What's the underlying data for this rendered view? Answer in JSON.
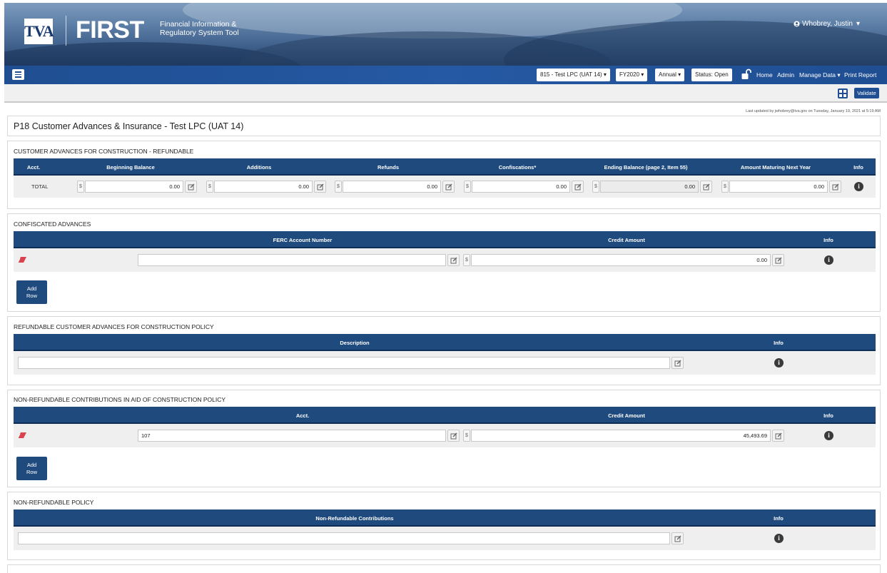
{
  "header": {
    "logo_tva": "TVA",
    "logo_first": "FIRST",
    "logo_subtitle_line1": "Financial Information &",
    "logo_subtitle_line2": "Regulatory System Tool",
    "user_name": "Whobrey, Justin",
    "user_caret": "▾"
  },
  "navbar": {
    "entity_select": "815 - Test LPC (UAT 14) ▾",
    "year_select": "FY2020 ▾",
    "period_select": "Annual ▾",
    "status": "Status: Open",
    "links": {
      "home": "Home",
      "admin": "Admin",
      "manage_data": "Manage Data ▾",
      "print_report": "Print Report"
    }
  },
  "toolbar": {
    "validate_label": "Validate",
    "last_updated": "Last updated by jwhobrey@tva.gov on Tuesday, January 19, 2021 at 5:19 AM"
  },
  "page": {
    "title": "P18 Customer Advances & Insurance - Test LPC (UAT 14)"
  },
  "sections": {
    "refundable": {
      "title": "CUSTOMER ADVANCES FOR CONSTRUCTION - REFUNDABLE",
      "columns": [
        "Acct.",
        "Beginning Balance",
        "Additions",
        "Refunds",
        "Confiscations*",
        "Ending Balance (page 2, Item 55)",
        "Amount Maturing Next Year",
        "Info"
      ],
      "row_label": "TOTAL",
      "currency_symbol": "$",
      "values": [
        "0.00",
        "0.00",
        "0.00",
        "0.00",
        "0.00",
        "0.00"
      ]
    },
    "confiscated": {
      "title": "CONFISCATED ADVANCES",
      "columns": [
        "FERC Account Number",
        "Credit Amount",
        "Info"
      ],
      "account_value": "",
      "currency_symbol": "$",
      "credit_value": "0.00",
      "add_row_line1": "Add",
      "add_row_line2": "Row"
    },
    "refundable_policy": {
      "title": "REFUNDABLE CUSTOMER ADVANCES FOR CONSTRUCTION POLICY",
      "columns": [
        "Description",
        "Info"
      ],
      "description_value": ""
    },
    "nonrefundable_contrib": {
      "title": "NON-REFUNDABLE CONTRIBUTIONS IN AID OF CONSTRUCTION POLICY",
      "columns": [
        "Acct.",
        "Credit Amount",
        "Info"
      ],
      "acct_value": "107",
      "currency_symbol": "$",
      "credit_value": "45,493.69",
      "add_row_line1": "Add",
      "add_row_line2": "Row"
    },
    "nonrefundable_policy": {
      "title": "NON-REFUNDABLE POLICY",
      "columns": [
        "Non-Refundable Contributions",
        "Info"
      ],
      "value": ""
    }
  },
  "icons": {
    "info_glyph": "i",
    "user_icon": "user-circle-icon",
    "lock_icon": "unlocked-padlock-icon",
    "edit_icon": "pencil-square-icon",
    "eraser_icon": "eraser-icon"
  },
  "colors": {
    "nav_blue": "#1f4e92",
    "table_header": "#1f4a7e",
    "eraser_red": "#d9434f"
  }
}
